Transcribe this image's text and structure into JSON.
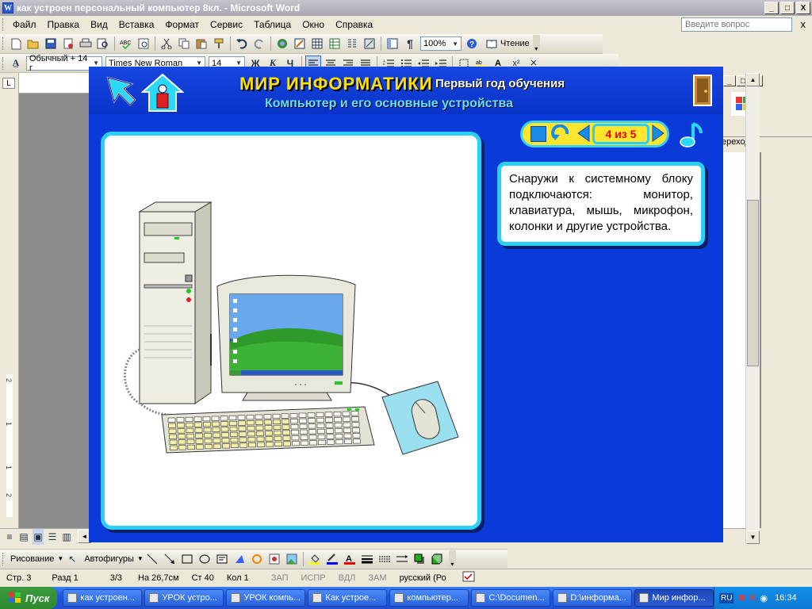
{
  "window": {
    "title": "как устроен персональный компьютер 8кл. - Microsoft Word",
    "icon_label": "W"
  },
  "title_buttons": {
    "minimize": "_",
    "maximize": "□",
    "close": "X"
  },
  "menu": {
    "items": [
      "Файл",
      "Правка",
      "Вид",
      "Вставка",
      "Формат",
      "Сервис",
      "Таблица",
      "Окно",
      "Справка"
    ],
    "close": "x"
  },
  "help": {
    "placeholder": "Введите вопрос"
  },
  "toolbar": {
    "zoom": "100%",
    "read_label": "Чтение"
  },
  "format_bar": {
    "style": "Обычный + 14 г",
    "font": "Times New Roman",
    "size": "14",
    "bold": "Ж",
    "italic": "К",
    "underline": "Ч"
  },
  "ruler": {
    "corner": "L",
    "marks": [
      "2",
      "1",
      "1",
      "2"
    ]
  },
  "right_panel": {
    "label": "ереход"
  },
  "app": {
    "title_main": "МИР  ИНФОРМАТИКИ",
    "title_sub": "Первый  год  обучения",
    "subtitle": "Компьютер и его основные устройства",
    "counter": "4 из 5",
    "info_text": "Снаружи к системному блоку подключаются: монитор, клавиатура, мышь, микрофон, колонки и другие устройства.",
    "minimize": "_"
  },
  "drawing_bar": {
    "draw_label": "Рисование",
    "autoshapes_label": "Автофигуры"
  },
  "status": {
    "page": "Стр.  3",
    "section": "Разд  1",
    "pages": "3/3",
    "position": "На 26,7см",
    "line": "Ст 40",
    "col": "Кол 1",
    "rec": "ЗАП",
    "trk": "ИСПР",
    "ext": "ВДЛ",
    "ovr": "ЗАМ",
    "lang": "русский (Ро"
  },
  "taskbar": {
    "start": "Пуск",
    "tasks": [
      "как устроен...",
      "УРОК устро...",
      "УРОК компь...",
      "Как устрое...",
      "компьютер...",
      "C:\\Documen...",
      "D:\\информа...",
      "Мир инфор..."
    ],
    "active_index": 7,
    "lang": "RU",
    "time": "16:34"
  },
  "colors": {
    "app_bg": "#0a3ad8",
    "title_yellow": "#ffe000",
    "subtitle_cyan": "#68e0ff",
    "panel_border": "#2ad0f8",
    "counter_red": "#ee0000",
    "nav_yellow": "#ffe62c"
  }
}
